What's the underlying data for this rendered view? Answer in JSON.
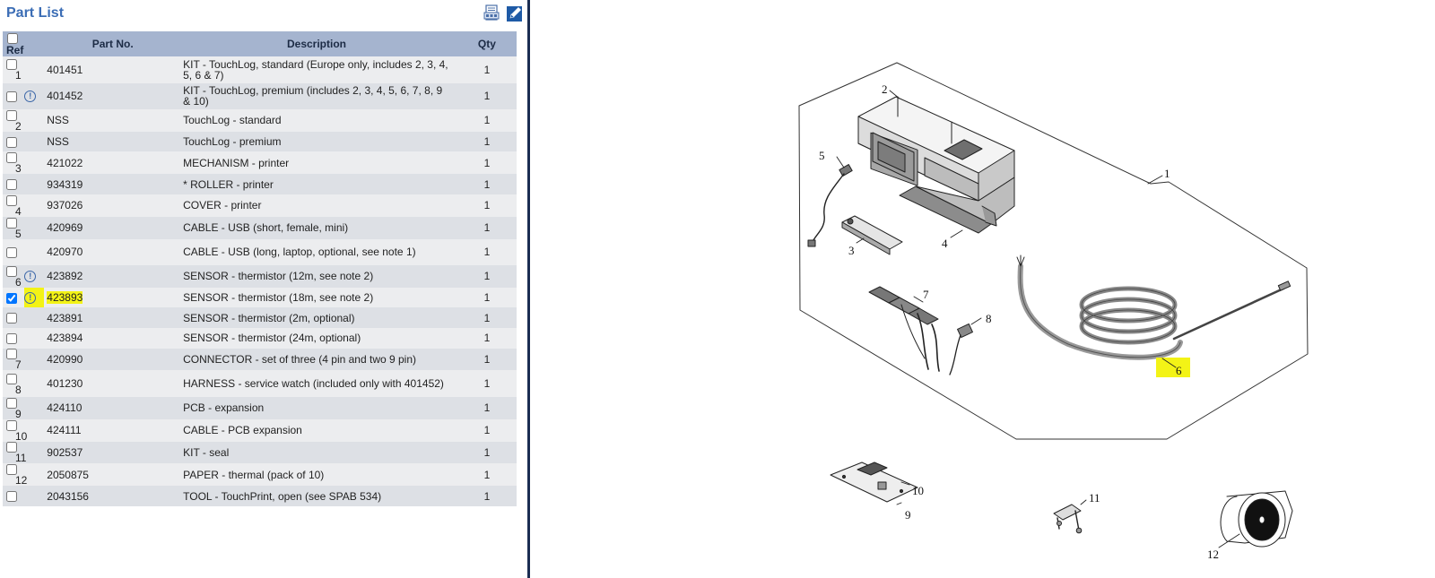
{
  "panel": {
    "title": "Part List",
    "pdf_icon": "pdf-print-icon",
    "edit_icon": "edit-pencil-icon"
  },
  "table": {
    "headers": {
      "ref": "Ref",
      "part": "Part No.",
      "desc": "Description",
      "qty": "Qty"
    },
    "rows": [
      {
        "ref": "1",
        "note": false,
        "part": "401451",
        "desc": "KIT - TouchLog, standard (Europe only, includes 2, 3, 4, 5, 6 & 7)",
        "qty": "1",
        "checked": false
      },
      {
        "ref": "",
        "note": true,
        "part": "401452",
        "desc": "KIT - TouchLog, premium (includes 2, 3, 4, 5, 6, 7, 8, 9 & 10)",
        "qty": "1",
        "checked": false
      },
      {
        "ref": "2",
        "note": false,
        "part": "NSS",
        "desc": "TouchLog - standard",
        "qty": "1",
        "checked": false
      },
      {
        "ref": "",
        "note": false,
        "part": "NSS",
        "desc": "TouchLog - premium",
        "qty": "1",
        "checked": false
      },
      {
        "ref": "3",
        "note": false,
        "part": "421022",
        "desc": "MECHANISM - printer",
        "qty": "1",
        "checked": false
      },
      {
        "ref": "",
        "note": false,
        "part": "934319",
        "desc": "* ROLLER - printer",
        "qty": "1",
        "checked": false
      },
      {
        "ref": "4",
        "note": false,
        "part": "937026",
        "desc": "COVER - printer",
        "qty": "1",
        "checked": false
      },
      {
        "ref": "5",
        "note": false,
        "part": "420969",
        "desc": "CABLE - USB (short, female, mini)",
        "qty": "1",
        "checked": false
      },
      {
        "ref": "",
        "note": false,
        "part": "420970",
        "desc": "CABLE - USB (long, laptop, optional, see note 1)",
        "qty": "1",
        "checked": false
      },
      {
        "ref": "6",
        "note": true,
        "part": "423892",
        "desc": "SENSOR - thermistor (12m, see note 2)",
        "qty": "1",
        "checked": false
      },
      {
        "ref": "",
        "note": true,
        "part": "423893",
        "desc": "SENSOR - thermistor (18m, see note 2)",
        "qty": "1",
        "checked": true,
        "highlight": true
      },
      {
        "ref": "",
        "note": false,
        "part": "423891",
        "desc": "SENSOR - thermistor (2m, optional)",
        "qty": "1",
        "checked": false
      },
      {
        "ref": "",
        "note": false,
        "part": "423894",
        "desc": "SENSOR - thermistor (24m, optional)",
        "qty": "1",
        "checked": false
      },
      {
        "ref": "7",
        "note": false,
        "part": "420990",
        "desc": "CONNECTOR - set of three (4 pin and two 9 pin)",
        "qty": "1",
        "checked": false
      },
      {
        "ref": "8",
        "note": false,
        "part": "401230",
        "desc": "HARNESS - service watch (included only with 401452)",
        "qty": "1",
        "checked": false
      },
      {
        "ref": "9",
        "note": false,
        "part": "424110",
        "desc": "PCB - expansion",
        "qty": "1",
        "checked": false
      },
      {
        "ref": "10",
        "note": false,
        "part": "424111",
        "desc": "CABLE - PCB expansion",
        "qty": "1",
        "checked": false
      },
      {
        "ref": "11",
        "note": false,
        "part": "902537",
        "desc": "KIT - seal",
        "qty": "1",
        "checked": false
      },
      {
        "ref": "12",
        "note": false,
        "part": "2050875",
        "desc": "PAPER - thermal (pack of 10)",
        "qty": "1",
        "checked": false
      },
      {
        "ref": "",
        "note": false,
        "part": "2043156",
        "desc": "TOOL - TouchPrint, open (see SPAB 534)",
        "qty": "1",
        "checked": false
      }
    ]
  },
  "diagram": {
    "callouts": [
      "1",
      "2",
      "3",
      "4",
      "5",
      "6",
      "7",
      "8",
      "9",
      "10",
      "11",
      "12"
    ],
    "highlight_callout": "6",
    "highlight_color": "#f3f316"
  }
}
